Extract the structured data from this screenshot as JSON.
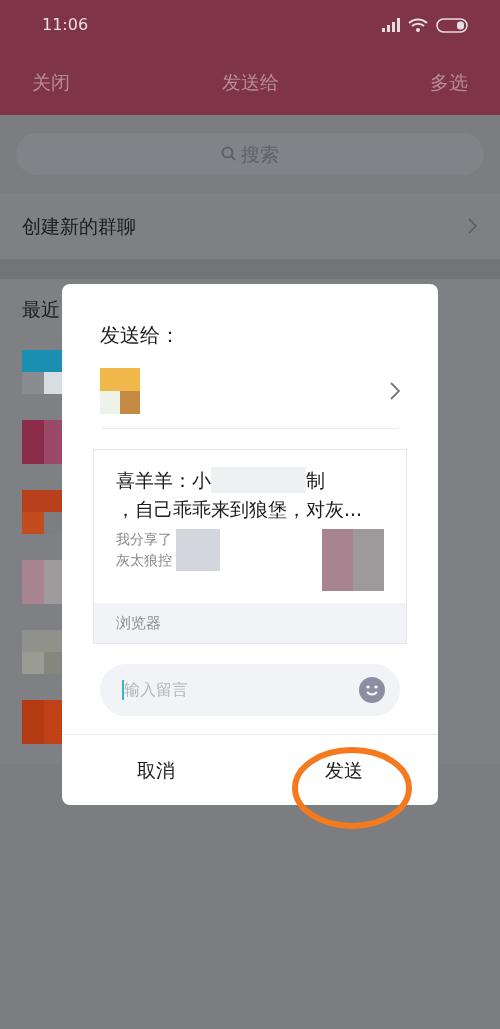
{
  "status_bar": {
    "time": "11:06"
  },
  "nav": {
    "left": "关闭",
    "title": "发送给",
    "right": "多选"
  },
  "search": {
    "placeholder": "搜索"
  },
  "create_group": {
    "label": "创建新的群聊"
  },
  "recent": {
    "heading": "最近"
  },
  "dialog": {
    "title": "发送给：",
    "card": {
      "title_start": "喜羊羊：小",
      "title_end": "制",
      "title_line2": "，自己乖乖来到狼堡，对灰...",
      "description_line1": "我分享了",
      "description_line2": "灰太狼控",
      "source": "浏览器"
    },
    "message": {
      "placeholder": "输入留言",
      "focused": true
    },
    "buttons": [
      {
        "label": "取消",
        "highlighted": false
      },
      {
        "label": "发送",
        "highlighted": true
      }
    ]
  }
}
